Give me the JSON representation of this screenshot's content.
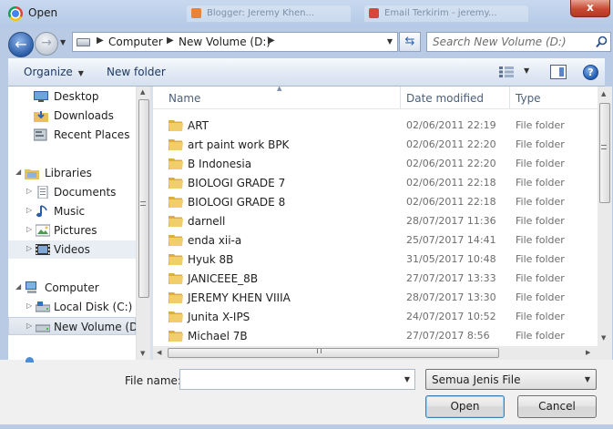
{
  "window": {
    "title": "Open",
    "close_label": "x",
    "background_tabs": [
      "Blogger: Jeremy Khen...",
      "Email Terkirim - jeremy..."
    ]
  },
  "navigation": {
    "back_icon": "back-arrow-icon",
    "forward_icon": "forward-arrow-icon",
    "breadcrumb": [
      "Computer",
      "New Volume (D:)"
    ],
    "search_placeholder": "Search New Volume (D:)"
  },
  "toolbar": {
    "organize_label": "Organize",
    "new_folder_label": "New folder",
    "help_label": "?"
  },
  "sidebar": {
    "items": [
      {
        "label": "Desktop",
        "icon": "desktop-icon"
      },
      {
        "label": "Downloads",
        "icon": "downloads-folder-icon"
      },
      {
        "label": "Recent Places",
        "icon": "recent-places-icon"
      },
      {
        "label": "Libraries",
        "icon": "libraries-icon"
      },
      {
        "label": "Documents",
        "icon": "documents-icon"
      },
      {
        "label": "Music",
        "icon": "music-icon"
      },
      {
        "label": "Pictures",
        "icon": "pictures-icon"
      },
      {
        "label": "Videos",
        "icon": "videos-icon"
      },
      {
        "label": "Computer",
        "icon": "computer-icon"
      },
      {
        "label": "Local Disk (C:)",
        "icon": "local-disk-icon"
      },
      {
        "label": "New Volume (D:)",
        "icon": "drive-icon"
      }
    ]
  },
  "file_list": {
    "columns": [
      "Name",
      "Date modified",
      "Type"
    ],
    "rows": [
      {
        "name": "ART",
        "date": "02/06/2011 22:19",
        "type": "File folder"
      },
      {
        "name": "art paint work BPK",
        "date": "02/06/2011 22:20",
        "type": "File folder"
      },
      {
        "name": "B Indonesia",
        "date": "02/06/2011 22:20",
        "type": "File folder"
      },
      {
        "name": "BIOLOGI GRADE 7",
        "date": "02/06/2011 22:18",
        "type": "File folder"
      },
      {
        "name": "BIOLOGI GRADE 8",
        "date": "02/06/2011 22:18",
        "type": "File folder"
      },
      {
        "name": "darnell",
        "date": "28/07/2017 11:36",
        "type": "File folder"
      },
      {
        "name": "enda xii-a",
        "date": "25/07/2017 14:41",
        "type": "File folder"
      },
      {
        "name": "Hyuk 8B",
        "date": "31/05/2017 10:48",
        "type": "File folder"
      },
      {
        "name": "JANICEEE_8B",
        "date": "27/07/2017 13:33",
        "type": "File folder"
      },
      {
        "name": "JEREMY KHEN VIIIA",
        "date": "28/07/2017 13:30",
        "type": "File folder"
      },
      {
        "name": "Junita X-IPS",
        "date": "24/07/2017 10:52",
        "type": "File folder"
      },
      {
        "name": "Michael 7B",
        "date": "27/07/2017 8:56",
        "type": "File folder"
      }
    ]
  },
  "footer": {
    "file_name_label": "File name:",
    "file_name_value": "",
    "file_type_value": "Semua Jenis File",
    "open_label": "Open",
    "cancel_label": "Cancel"
  },
  "colors": {
    "frame": "#b9cbe4",
    "folder": "#e9c15c",
    "selection": "#d9e0ea",
    "close_button": "#c74a33"
  }
}
